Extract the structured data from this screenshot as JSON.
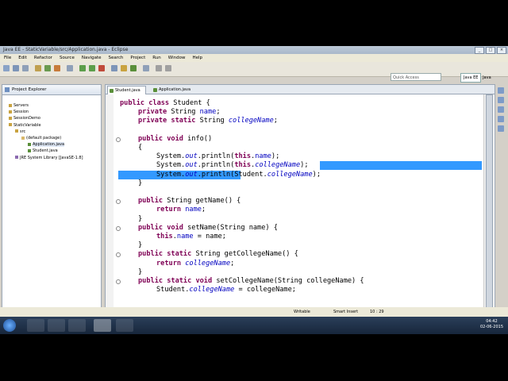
{
  "window": {
    "title": "Java EE - StaticVariable/src/Application.java - Eclipse"
  },
  "menu": [
    "File",
    "Edit",
    "Refactor",
    "Source",
    "Navigate",
    "Search",
    "Project",
    "Run",
    "Window",
    "Help"
  ],
  "quick_access": {
    "placeholder": "Quick Access"
  },
  "perspectives": [
    "Java EE",
    "Java"
  ],
  "project_explorer": {
    "title": "Project Explorer",
    "items": [
      {
        "label": "Servers"
      },
      {
        "label": "Session"
      },
      {
        "label": "SessionDemo"
      },
      {
        "label": "StaticVariable"
      },
      {
        "label": "src"
      },
      {
        "label": "(default package)"
      },
      {
        "label": "Application.java"
      },
      {
        "label": "Student.java"
      },
      {
        "label": "JRE System Library [JavaSE-1.8]"
      }
    ]
  },
  "editor": {
    "tabs": [
      {
        "label": "Student.java"
      },
      {
        "label": "Application.java"
      }
    ],
    "lines": [
      {
        "indent": 0,
        "parts": [
          [
            "kw",
            "public "
          ],
          [
            "kw",
            "class "
          ],
          [
            "p",
            "Student {"
          ]
        ]
      },
      {
        "indent": 1,
        "parts": [
          [
            "kw",
            "private "
          ],
          [
            "p",
            "String "
          ],
          [
            "fld",
            "name"
          ],
          [
            "p",
            ";"
          ]
        ]
      },
      {
        "indent": 1,
        "parts": [
          [
            "kw",
            "private "
          ],
          [
            "kw",
            "static "
          ],
          [
            "p",
            "String "
          ],
          [
            "fld it",
            "collegeName"
          ],
          [
            "p",
            ";"
          ]
        ]
      },
      {
        "indent": 0,
        "parts": []
      },
      {
        "indent": 1,
        "parts": [
          [
            "kw",
            "public "
          ],
          [
            "kw",
            "void "
          ],
          [
            "p",
            "info()"
          ]
        ]
      },
      {
        "indent": 1,
        "parts": [
          [
            "p",
            "{"
          ]
        ]
      },
      {
        "indent": 2,
        "parts": [
          [
            "p",
            "System."
          ],
          [
            "fld it",
            "out"
          ],
          [
            "p",
            ".println("
          ],
          [
            "kw",
            "this"
          ],
          [
            "p",
            "."
          ],
          [
            "fld",
            "name"
          ],
          [
            "p",
            ");"
          ]
        ]
      },
      {
        "indent": 2,
        "parts": [
          [
            "p",
            "System."
          ],
          [
            "fld it",
            "out"
          ],
          [
            "p",
            ".println("
          ],
          [
            "kw",
            "this"
          ],
          [
            "p",
            "."
          ],
          [
            "fld it",
            "collegeName"
          ],
          [
            "p",
            ");"
          ]
        ]
      },
      {
        "indent": 2,
        "parts": [
          [
            "p",
            "System."
          ],
          [
            "fld it",
            "out"
          ],
          [
            "p",
            ".println(Student."
          ],
          [
            "fld it",
            "collegeName"
          ],
          [
            "p",
            ");"
          ]
        ]
      },
      {
        "indent": 1,
        "parts": [
          [
            "p",
            "}"
          ]
        ]
      },
      {
        "indent": 0,
        "parts": []
      },
      {
        "indent": 1,
        "parts": [
          [
            "kw",
            "public "
          ],
          [
            "p",
            "String getName() {"
          ]
        ]
      },
      {
        "indent": 2,
        "parts": [
          [
            "kw",
            "return "
          ],
          [
            "fld",
            "name"
          ],
          [
            "p",
            ";"
          ]
        ]
      },
      {
        "indent": 1,
        "parts": [
          [
            "p",
            "}"
          ]
        ]
      },
      {
        "indent": 1,
        "parts": [
          [
            "kw",
            "public "
          ],
          [
            "kw",
            "void "
          ],
          [
            "p",
            "setName(String name) {"
          ]
        ]
      },
      {
        "indent": 2,
        "parts": [
          [
            "kw",
            "this"
          ],
          [
            "p",
            "."
          ],
          [
            "fld",
            "name"
          ],
          [
            "p",
            " = name;"
          ]
        ]
      },
      {
        "indent": 1,
        "parts": [
          [
            "p",
            "}"
          ]
        ]
      },
      {
        "indent": 1,
        "parts": [
          [
            "kw",
            "public "
          ],
          [
            "kw",
            "static "
          ],
          [
            "p",
            "String getCollegeName() {"
          ]
        ]
      },
      {
        "indent": 2,
        "parts": [
          [
            "kw",
            "return "
          ],
          [
            "fld it",
            "collegeName"
          ],
          [
            "p",
            ";"
          ]
        ]
      },
      {
        "indent": 1,
        "parts": [
          [
            "p",
            "}"
          ]
        ]
      },
      {
        "indent": 1,
        "parts": [
          [
            "kw",
            "public "
          ],
          [
            "kw",
            "static "
          ],
          [
            "kw",
            "void "
          ],
          [
            "p",
            "setCollegeName(String collegeName) {"
          ]
        ]
      },
      {
        "indent": 2,
        "parts": [
          [
            "p",
            "Student."
          ],
          [
            "fld it",
            "collegeName"
          ],
          [
            "p",
            " = collegeName;"
          ]
        ]
      }
    ]
  },
  "status": {
    "writable": "Writable",
    "insert_mode": "Smart Insert",
    "position": "10 : 29"
  },
  "taskbar": {
    "time": "04:42",
    "date": "02-06-2015"
  }
}
